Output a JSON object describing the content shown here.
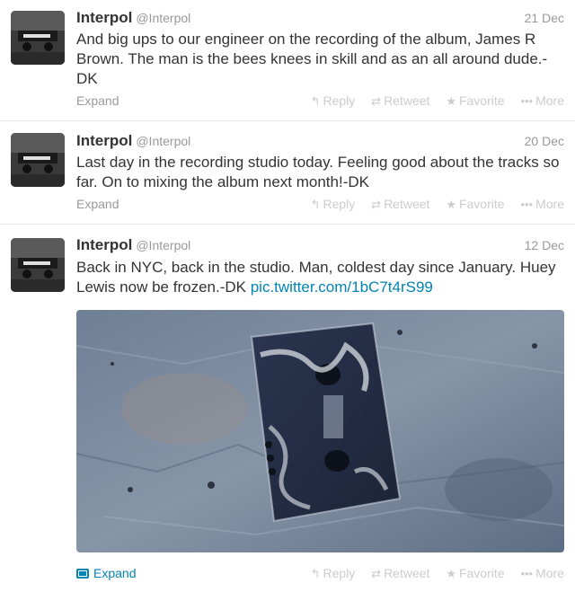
{
  "tweets": [
    {
      "name": "Interpol",
      "handle": "@Interpol",
      "date": "21 Dec",
      "text": "And big ups to our engineer on the recording of the album, James R Brown. The man is the bees knees in skill and as an all around dude.-DK",
      "expand": "Expand"
    },
    {
      "name": "Interpol",
      "handle": "@Interpol",
      "date": "20 Dec",
      "text": "Last day in the recording studio today. Feeling good about the tracks so far. On to mixing the album next month!-DK",
      "expand": "Expand"
    },
    {
      "name": "Interpol",
      "handle": "@Interpol",
      "date": "12 Dec",
      "text": "Back in NYC, back in the studio. Man, coldest day since January. Huey Lewis now be frozen.-DK",
      "link": "pic.twitter.com/1bC7t4rS99",
      "expand": "Expand"
    }
  ],
  "actions": {
    "reply": "Reply",
    "retweet": "Retweet",
    "favorite": "Favorite",
    "more": "More"
  },
  "icons": {
    "reply": "reply-arrow-icon",
    "retweet": "retweet-icon",
    "favorite": "star-icon",
    "more": "dots-icon",
    "media": "photo-icon"
  },
  "colors": {
    "link": "#0084b4",
    "muted": "#999999",
    "actions": "#cccccc"
  }
}
